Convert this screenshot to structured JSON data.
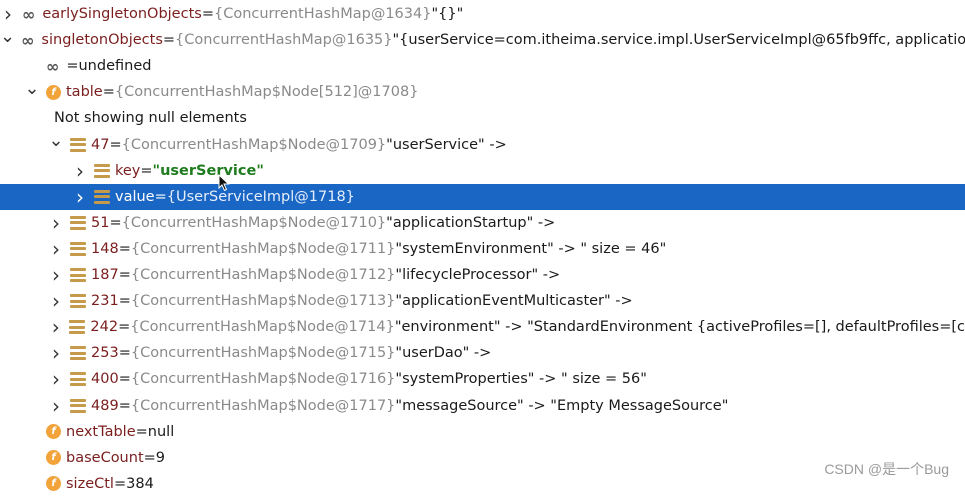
{
  "rows": [
    {
      "indent": 0,
      "arrow": ">",
      "icon": "oo",
      "name": "earlySingletonObjects",
      "eq": " = ",
      "type": "{ConcurrentHashMap@1634}",
      "val": " \"{}\""
    },
    {
      "indent": 0,
      "arrow": "v",
      "icon": "oo",
      "name": "singletonObjects",
      "eq": " = ",
      "type": "{ConcurrentHashMap@1635}",
      "val": " \"{userService=com.itheima.service.impl.UserServiceImpl@65fb9ffc, applicatio"
    },
    {
      "indent": 1,
      "arrow": "",
      "icon": "oo",
      "name": "",
      "eq": " = ",
      "type": "",
      "val": "undefined"
    },
    {
      "indent": 1,
      "arrow": "v",
      "icon": "f",
      "name": "table",
      "eq": " = ",
      "type": "{ConcurrentHashMap$Node[512]@1708}",
      "val": ""
    },
    {
      "indent": 2,
      "arrow": "",
      "icon": "",
      "name": "",
      "eq": "",
      "type": "",
      "val": "Not showing null elements"
    },
    {
      "indent": 2,
      "arrow": "v",
      "icon": "bars",
      "name": "47",
      "eq": " = ",
      "type": "{ConcurrentHashMap$Node@1709}",
      "val": " \"userService\" ->"
    },
    {
      "indent": 3,
      "arrow": ">",
      "icon": "bars",
      "name": "key",
      "eq": " = ",
      "type": "",
      "val": "\"userService\"",
      "valstyle": "str"
    },
    {
      "indent": 3,
      "arrow": ">",
      "icon": "bars",
      "name": "value",
      "eq": " = ",
      "type": "{UserServiceImpl@1718}",
      "val": "",
      "selected": true
    },
    {
      "indent": 2,
      "arrow": ">",
      "icon": "bars",
      "name": "51",
      "eq": " = ",
      "type": "{ConcurrentHashMap$Node@1710}",
      "val": " \"applicationStartup\" ->"
    },
    {
      "indent": 2,
      "arrow": ">",
      "icon": "bars",
      "name": "148",
      "eq": " = ",
      "type": "{ConcurrentHashMap$Node@1711}",
      "val": " \"systemEnvironment\" -> \" size = 46\""
    },
    {
      "indent": 2,
      "arrow": ">",
      "icon": "bars",
      "name": "187",
      "eq": " = ",
      "type": "{ConcurrentHashMap$Node@1712}",
      "val": " \"lifecycleProcessor\" ->"
    },
    {
      "indent": 2,
      "arrow": ">",
      "icon": "bars",
      "name": "231",
      "eq": " = ",
      "type": "{ConcurrentHashMap$Node@1713}",
      "val": " \"applicationEventMulticaster\" ->"
    },
    {
      "indent": 2,
      "arrow": ">",
      "icon": "bars",
      "name": "242",
      "eq": " = ",
      "type": "{ConcurrentHashMap$Node@1714}",
      "val": " \"environment\" -> \"StandardEnvironment {activeProfiles=[], defaultProfiles=[c"
    },
    {
      "indent": 2,
      "arrow": ">",
      "icon": "bars",
      "name": "253",
      "eq": " = ",
      "type": "{ConcurrentHashMap$Node@1715}",
      "val": " \"userDao\" ->"
    },
    {
      "indent": 2,
      "arrow": ">",
      "icon": "bars",
      "name": "400",
      "eq": " = ",
      "type": "{ConcurrentHashMap$Node@1716}",
      "val": " \"systemProperties\" -> \" size = 56\""
    },
    {
      "indent": 2,
      "arrow": ">",
      "icon": "bars",
      "name": "489",
      "eq": " = ",
      "type": "{ConcurrentHashMap$Node@1717}",
      "val": " \"messageSource\" -> \"Empty MessageSource\""
    },
    {
      "indent": 1,
      "arrow": "",
      "icon": "f",
      "name": "nextTable",
      "eq": " = ",
      "type": "",
      "val": "null"
    },
    {
      "indent": 1,
      "arrow": "",
      "icon": "f",
      "name": "baseCount",
      "eq": " = ",
      "type": "",
      "val": "9"
    },
    {
      "indent": 1,
      "arrow": "",
      "icon": "f",
      "name": "sizeCtl",
      "eq": " = ",
      "type": "",
      "val": "384"
    }
  ],
  "watermark": "CSDN @是一个Bug",
  "colors": {
    "selection": "#1a66c4",
    "field_icon": "#f2a33a",
    "string": "#1e7b1e"
  }
}
